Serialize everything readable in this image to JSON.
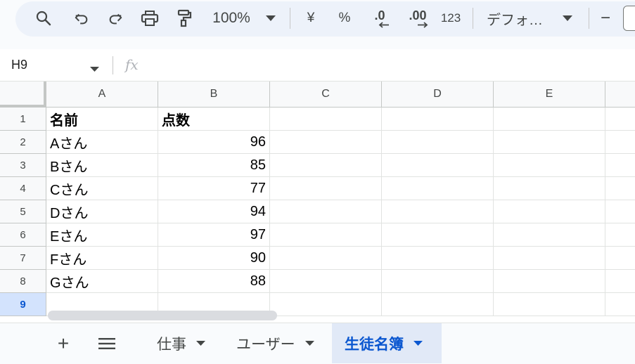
{
  "toolbar": {
    "zoom": "100%",
    "currency_symbol": "¥",
    "percent_symbol": "%",
    "decrease_decimal_label": ".0",
    "increase_decimal_label": ".00",
    "number_format_label": "123",
    "font_name": "デフォ…",
    "font_size_minus": "−"
  },
  "formula_bar": {
    "cell_ref": "H9",
    "fx_label": "fx"
  },
  "grid": {
    "columns": [
      "A",
      "B",
      "C",
      "D",
      "E"
    ],
    "rows": [
      {
        "num": "1",
        "a": "名前",
        "b": "点数"
      },
      {
        "num": "2",
        "a": "Aさん",
        "b": "96"
      },
      {
        "num": "3",
        "a": "Bさん",
        "b": "85"
      },
      {
        "num": "4",
        "a": "Cさん",
        "b": "77"
      },
      {
        "num": "5",
        "a": "Dさん",
        "b": "94"
      },
      {
        "num": "6",
        "a": "Eさん",
        "b": "97"
      },
      {
        "num": "7",
        "a": "Fさん",
        "b": "90"
      },
      {
        "num": "8",
        "a": "Gさん",
        "b": "88"
      },
      {
        "num": "9",
        "a": "",
        "b": ""
      }
    ],
    "active_row": "9"
  },
  "sheets": {
    "add_label": "+",
    "all_sheets_label": "≡",
    "tabs": [
      {
        "label": "仕事",
        "active": false
      },
      {
        "label": "ユーザー",
        "active": false
      },
      {
        "label": "生徒名簿",
        "active": true
      }
    ]
  },
  "colors": {
    "accent": "#0b57d0",
    "active_tab_bg": "#e1e9f7",
    "toolbar_bg": "#edf2fa"
  }
}
